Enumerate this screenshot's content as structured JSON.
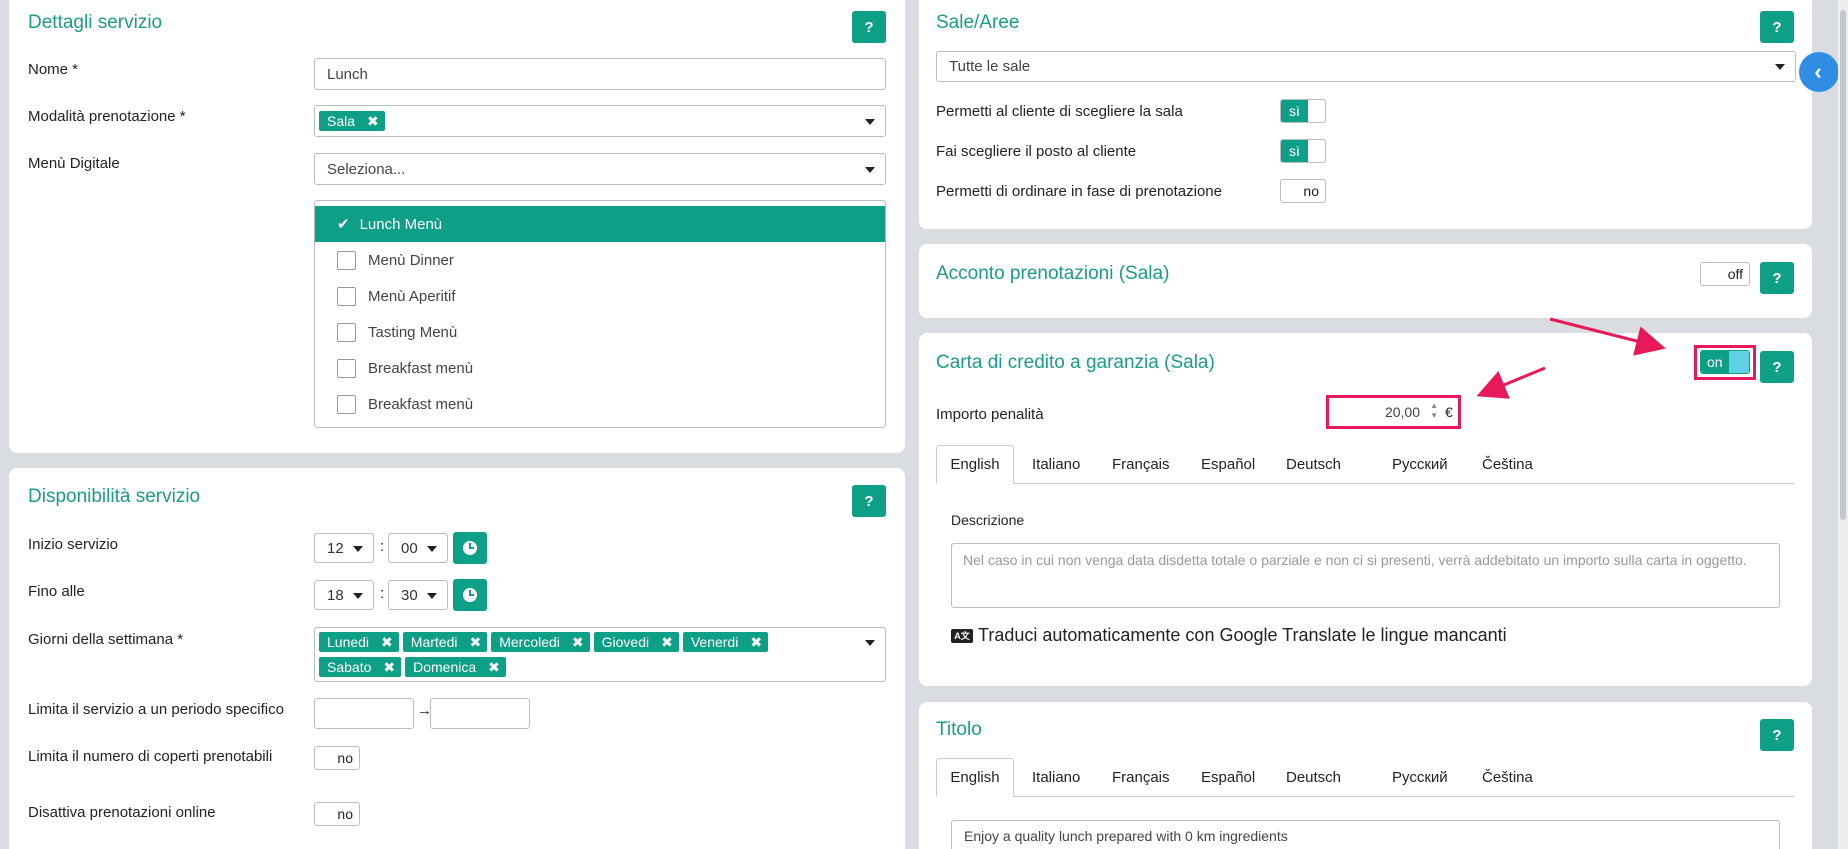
{
  "dettagli": {
    "title": "Dettagli servizio",
    "help": "?",
    "nome_label": "Nome *",
    "nome_value": "Lunch",
    "modalita_label": "Modalità prenotazione *",
    "modalita_tag": "Sala",
    "menu_label": "Menù Digitale",
    "menu_placeholder": "Seleziona...",
    "menu_options": [
      {
        "label": "Lunch Menù",
        "checked": true
      },
      {
        "label": "Menù Dinner",
        "checked": false
      },
      {
        "label": "Menù Aperitif",
        "checked": false
      },
      {
        "label": "Tasting Menù",
        "checked": false
      },
      {
        "label": "Breakfast menù",
        "checked": false
      },
      {
        "label": "Breakfast menù",
        "checked": false
      }
    ]
  },
  "disponibilita": {
    "title": "Disponibilità servizio",
    "help": "?",
    "inizio_label": "Inizio servizio",
    "inizio_h": "12",
    "inizio_m": "00",
    "fino_label": "Fino alle",
    "fino_h": "18",
    "fino_m": "30",
    "sep": ":",
    "giorni_label": "Giorni della settimana *",
    "giorni": [
      "Lunedi",
      "Martedi",
      "Mercoledi",
      "Giovedi",
      "Venerdi",
      "Sabato",
      "Domenica"
    ],
    "periodo_label": "Limita il servizio a un periodo specifico",
    "arrow": "→",
    "coperti_label": "Limita il numero di coperti prenotabili",
    "coperti_toggle": "no",
    "online_label": "Disattiva prenotazioni online",
    "online_toggle": "no"
  },
  "sale": {
    "title": "Sale/Aree",
    "help": "?",
    "select_value": "Tutte le sale",
    "opt1_label": "Permetti al cliente di scegliere la sala",
    "opt1_toggle": "sì",
    "opt2_label": "Fai scegliere il posto al cliente",
    "opt2_toggle": "sì",
    "opt3_label": "Permetti di ordinare in fase di prenotazione",
    "opt3_toggle": "no"
  },
  "acconto": {
    "title": "Acconto prenotazioni (Sala)",
    "toggle": "off",
    "help": "?"
  },
  "carta": {
    "title": "Carta di credito a garanzia (Sala)",
    "toggle": "on",
    "help": "?",
    "importo_label": "Importo penalità",
    "importo_value": "20,00",
    "currency": "€",
    "tabs": [
      "English",
      "Italiano",
      "Français",
      "Español",
      "Deutsch",
      "Русский",
      "Čeština"
    ],
    "descrizione_label": "Descrizione",
    "descrizione_placeholder": "Nel caso in cui non venga data disdetta totale o parziale e non ci si presenti, verrà addebitato un importo sulla carta in oggetto.",
    "translate_text": "Traduci automaticamente con Google Translate le lingue mancanti"
  },
  "titolo": {
    "title": "Titolo",
    "help": "?",
    "tabs": [
      "English",
      "Italiano",
      "Français",
      "Español",
      "Deutsch",
      "Русский",
      "Čeština"
    ],
    "value": "Enjoy a quality lunch prepared with 0 km ingredients"
  },
  "colors": {
    "accent": "#0e9f87",
    "title": "#1a9c86",
    "highlight": "#e8195a",
    "side_button": "#2f8de4"
  }
}
